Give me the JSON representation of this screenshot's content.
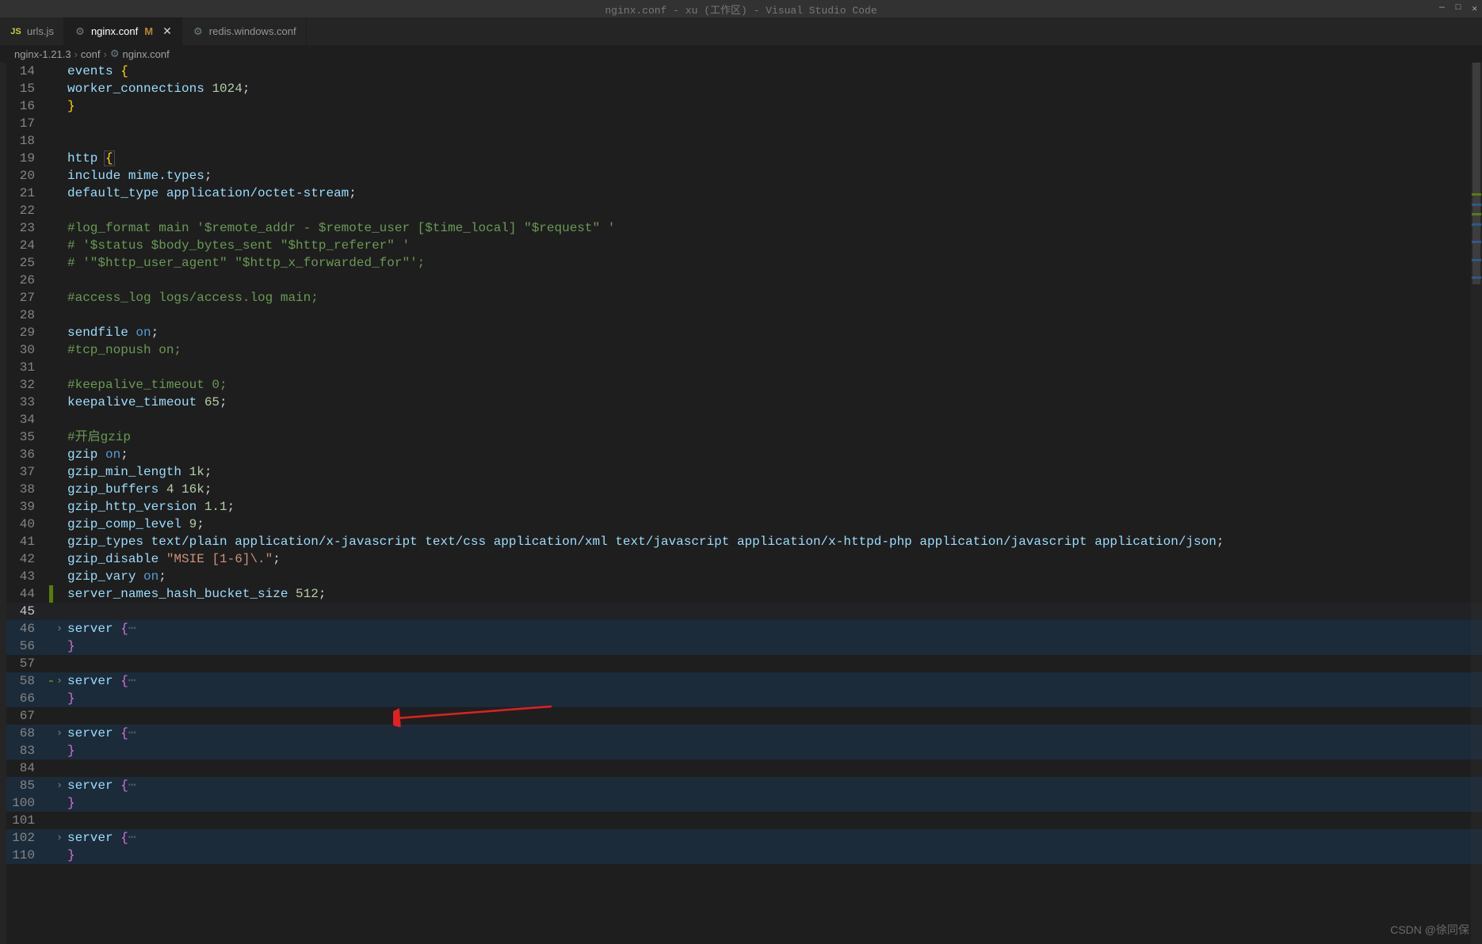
{
  "titlebar": {
    "text": "nginx.conf - xu (工作区) - Visual Studio Code"
  },
  "window_controls": [
    "—",
    "□",
    "✕"
  ],
  "tabs": [
    {
      "icon": "JS",
      "icon_type": "js",
      "label": "urls.js",
      "modified": "",
      "active": false,
      "close": false
    },
    {
      "icon": "⚙",
      "icon_type": "conf",
      "label": "nginx.conf",
      "modified": "M",
      "active": true,
      "close": true
    },
    {
      "icon": "⚙",
      "icon_type": "conf",
      "label": "redis.windows.conf",
      "modified": "",
      "active": false,
      "close": false
    }
  ],
  "breadcrumb": {
    "parts": [
      "nginx-1.21.3",
      "conf",
      "nginx.conf"
    ],
    "icon": "⚙"
  },
  "code_lines": [
    {
      "n": 14,
      "tokens": [
        {
          "t": "events ",
          "c": "id"
        },
        {
          "t": "{",
          "c": "br"
        }
      ]
    },
    {
      "n": 15,
      "tokens": [
        {
          "t": "    ",
          "c": "pn"
        },
        {
          "t": "worker_connections  ",
          "c": "id"
        },
        {
          "t": "1024",
          "c": "num"
        },
        {
          "t": ";",
          "c": "pn"
        }
      ]
    },
    {
      "n": 16,
      "tokens": [
        {
          "t": "}",
          "c": "br"
        }
      ]
    },
    {
      "n": 17,
      "tokens": []
    },
    {
      "n": 18,
      "tokens": []
    },
    {
      "n": 19,
      "tokens": [
        {
          "t": "http ",
          "c": "id"
        },
        {
          "t": "{",
          "c": "br br-bx"
        }
      ]
    },
    {
      "n": 20,
      "tokens": [
        {
          "t": "    ",
          "c": "pn"
        },
        {
          "t": "include       ",
          "c": "id"
        },
        {
          "t": "mime.types",
          "c": "id"
        },
        {
          "t": ";",
          "c": "pn"
        }
      ]
    },
    {
      "n": 21,
      "tokens": [
        {
          "t": "    ",
          "c": "pn"
        },
        {
          "t": "default_type  ",
          "c": "id"
        },
        {
          "t": "application/octet-stream",
          "c": "id"
        },
        {
          "t": ";",
          "c": "pn"
        }
      ]
    },
    {
      "n": 22,
      "tokens": []
    },
    {
      "n": 23,
      "tokens": [
        {
          "t": "    ",
          "c": "pn"
        },
        {
          "t": "#log_format  main  '$remote_addr - $remote_user [$time_local] \"$request\" '",
          "c": "cm"
        }
      ]
    },
    {
      "n": 24,
      "tokens": [
        {
          "t": "    ",
          "c": "pn"
        },
        {
          "t": "#                  '$status $body_bytes_sent \"$http_referer\" '",
          "c": "cm"
        }
      ]
    },
    {
      "n": 25,
      "tokens": [
        {
          "t": "    ",
          "c": "pn"
        },
        {
          "t": "#                  '\"$http_user_agent\" \"$http_x_forwarded_for\"';",
          "c": "cm"
        }
      ]
    },
    {
      "n": 26,
      "tokens": []
    },
    {
      "n": 27,
      "tokens": [
        {
          "t": "    ",
          "c": "pn"
        },
        {
          "t": "#access_log  logs/access.log  main;",
          "c": "cm"
        }
      ]
    },
    {
      "n": 28,
      "tokens": []
    },
    {
      "n": 29,
      "tokens": [
        {
          "t": "    ",
          "c": "pn"
        },
        {
          "t": "sendfile        ",
          "c": "id"
        },
        {
          "t": "on",
          "c": "kw"
        },
        {
          "t": ";",
          "c": "pn"
        }
      ]
    },
    {
      "n": 30,
      "tokens": [
        {
          "t": "    ",
          "c": "pn"
        },
        {
          "t": "#tcp_nopush     on;",
          "c": "cm"
        }
      ]
    },
    {
      "n": 31,
      "tokens": []
    },
    {
      "n": 32,
      "tokens": [
        {
          "t": "    ",
          "c": "pn"
        },
        {
          "t": "#keepalive_timeout  0;",
          "c": "cm"
        }
      ]
    },
    {
      "n": 33,
      "tokens": [
        {
          "t": "    ",
          "c": "pn"
        },
        {
          "t": "keepalive_timeout  ",
          "c": "id"
        },
        {
          "t": "65",
          "c": "num"
        },
        {
          "t": ";",
          "c": "pn"
        }
      ]
    },
    {
      "n": 34,
      "tokens": []
    },
    {
      "n": 35,
      "tokens": [
        {
          "t": "    ",
          "c": "pn"
        },
        {
          "t": "#开启gzip",
          "c": "cm"
        }
      ]
    },
    {
      "n": 36,
      "tokens": [
        {
          "t": "    ",
          "c": "pn"
        },
        {
          "t": "gzip  ",
          "c": "id"
        },
        {
          "t": "on",
          "c": "kw"
        },
        {
          "t": ";",
          "c": "pn"
        }
      ]
    },
    {
      "n": 37,
      "tokens": [
        {
          "t": "    ",
          "c": "pn"
        },
        {
          "t": "gzip_min_length  ",
          "c": "id"
        },
        {
          "t": "1k",
          "c": "num"
        },
        {
          "t": ";",
          "c": "pn"
        }
      ]
    },
    {
      "n": 38,
      "tokens": [
        {
          "t": "    ",
          "c": "pn"
        },
        {
          "t": "gzip_buffers     ",
          "c": "id"
        },
        {
          "t": "4 16k",
          "c": "num"
        },
        {
          "t": ";",
          "c": "pn"
        }
      ]
    },
    {
      "n": 39,
      "tokens": [
        {
          "t": "    ",
          "c": "pn"
        },
        {
          "t": "gzip_http_version ",
          "c": "id"
        },
        {
          "t": "1.1",
          "c": "num"
        },
        {
          "t": ";",
          "c": "pn"
        }
      ]
    },
    {
      "n": 40,
      "tokens": [
        {
          "t": "    ",
          "c": "pn"
        },
        {
          "t": "gzip_comp_level ",
          "c": "id"
        },
        {
          "t": "9",
          "c": "num"
        },
        {
          "t": ";",
          "c": "pn"
        }
      ]
    },
    {
      "n": 41,
      "tokens": [
        {
          "t": "    ",
          "c": "pn"
        },
        {
          "t": "gzip_types       text/plain application/x-javascript text/css application/xml text/javascript application/x-httpd-php application/javascript application/json",
          "c": "id"
        },
        {
          "t": ";",
          "c": "pn"
        }
      ]
    },
    {
      "n": 42,
      "tokens": [
        {
          "t": "    ",
          "c": "pn"
        },
        {
          "t": "gzip_disable ",
          "c": "id"
        },
        {
          "t": "\"MSIE [1-6]\\.\"",
          "c": "str"
        },
        {
          "t": ";",
          "c": "pn"
        }
      ]
    },
    {
      "n": 43,
      "tokens": [
        {
          "t": "    ",
          "c": "pn"
        },
        {
          "t": "gzip_vary ",
          "c": "id"
        },
        {
          "t": "on",
          "c": "kw"
        },
        {
          "t": ";",
          "c": "pn"
        }
      ]
    },
    {
      "n": 44,
      "git": "added",
      "tokens": [
        {
          "t": "    ",
          "c": "pn"
        },
        {
          "t": "server_names_hash_bucket_size ",
          "c": "id"
        },
        {
          "t": "512",
          "c": "num"
        },
        {
          "t": ";",
          "c": "pn"
        }
      ]
    },
    {
      "n": 45,
      "caret": true,
      "tokens": []
    },
    {
      "n": 46,
      "hl": true,
      "fold": ">",
      "tokens": [
        {
          "t": "    ",
          "c": "pn"
        },
        {
          "t": "server ",
          "c": "id"
        },
        {
          "t": "{",
          "c": "br2"
        },
        {
          "t": "⋯",
          "c": "dots"
        }
      ]
    },
    {
      "n": 56,
      "hl": true,
      "tokens": [
        {
          "t": "    ",
          "c": "pn"
        },
        {
          "t": "}",
          "c": "br2"
        }
      ]
    },
    {
      "n": 57,
      "tokens": []
    },
    {
      "n": 58,
      "git": "added-single",
      "fold": ">",
      "hl": true,
      "tokens": [
        {
          "t": "    ",
          "c": "pn"
        },
        {
          "t": "server ",
          "c": "id"
        },
        {
          "t": "{",
          "c": "br2"
        },
        {
          "t": "⋯",
          "c": "dots"
        }
      ]
    },
    {
      "n": 66,
      "hl": true,
      "tokens": [
        {
          "t": "    ",
          "c": "pn"
        },
        {
          "t": "}",
          "c": "br2"
        }
      ]
    },
    {
      "n": 67,
      "tokens": []
    },
    {
      "n": 68,
      "hl": true,
      "fold": ">",
      "tokens": [
        {
          "t": "    ",
          "c": "pn"
        },
        {
          "t": "server ",
          "c": "id"
        },
        {
          "t": "{",
          "c": "br2"
        },
        {
          "t": "⋯",
          "c": "dots"
        }
      ]
    },
    {
      "n": 83,
      "hl": true,
      "tokens": [
        {
          "t": "    ",
          "c": "pn"
        },
        {
          "t": "}",
          "c": "br2"
        }
      ]
    },
    {
      "n": 84,
      "tokens": []
    },
    {
      "n": 85,
      "hl": true,
      "fold": ">",
      "tokens": [
        {
          "t": "    ",
          "c": "pn"
        },
        {
          "t": "server ",
          "c": "id"
        },
        {
          "t": "{",
          "c": "br2"
        },
        {
          "t": "⋯",
          "c": "dots"
        }
      ]
    },
    {
      "n": 100,
      "hl": true,
      "tokens": [
        {
          "t": "    ",
          "c": "pn"
        },
        {
          "t": "}",
          "c": "br2"
        }
      ]
    },
    {
      "n": 101,
      "tokens": []
    },
    {
      "n": 102,
      "hl": true,
      "fold": ">",
      "tokens": [
        {
          "t": "    ",
          "c": "pn"
        },
        {
          "t": "server ",
          "c": "id"
        },
        {
          "t": "{",
          "c": "br2"
        },
        {
          "t": "⋯",
          "c": "dots"
        }
      ]
    },
    {
      "n": 110,
      "hl": true,
      "tokens": [
        {
          "t": "    ",
          "c": "pn"
        },
        {
          "t": "}",
          "c": "br2"
        }
      ]
    }
  ],
  "watermark": "CSDN @徐同保"
}
